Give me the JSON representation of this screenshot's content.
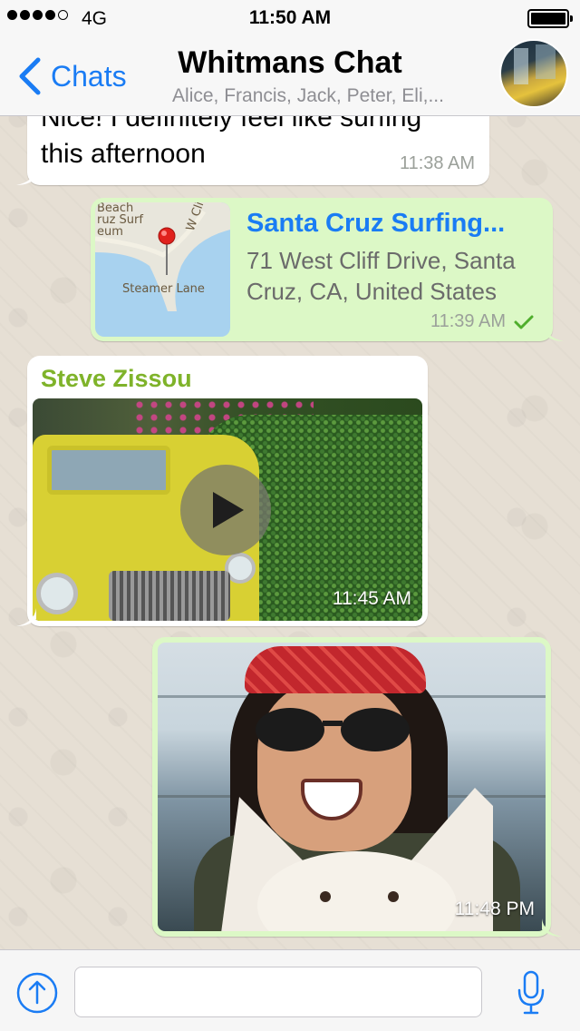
{
  "status_bar": {
    "network": "4G",
    "time": "11:50 AM",
    "signal_bars_filled": 4,
    "signal_bars_total": 5
  },
  "nav": {
    "back_label": "Chats",
    "title": "Whitmans Chat",
    "subtitle": "Alice, Francis, Jack, Peter, Eli,..."
  },
  "messages": [
    {
      "type": "text",
      "direction": "incoming",
      "text_line1": "Nice! I definitely feel like surfing",
      "text_line2": "this afternoon",
      "time": "11:38 AM"
    },
    {
      "type": "location",
      "direction": "outgoing",
      "title": "Santa Cruz Surfing...",
      "address_line1": "71 West Cliff Drive, Santa",
      "address_line2": "Cruz, CA, United States",
      "time": "11:39 AM",
      "status": "delivered",
      "map_labels": [
        "Beach",
        "ruz Surf",
        "eum",
        "W Cli",
        "Steamer Lane"
      ]
    },
    {
      "type": "video",
      "direction": "incoming",
      "sender": "Steve Zissou",
      "time": "11:45 AM"
    },
    {
      "type": "photo",
      "direction": "outgoing",
      "time": "11:48 PM"
    }
  ],
  "input": {
    "value": "",
    "placeholder": ""
  },
  "colors": {
    "accent": "#1a7cf4",
    "outgoing_bubble": "#dcf8c6",
    "incoming_bubble": "#ffffff",
    "sender_name": "#7fb32a",
    "check": "#4fae2c"
  },
  "icons": {
    "back": "chevron-left-icon",
    "attach": "upload-arrow-icon",
    "mic": "microphone-icon",
    "play": "play-icon",
    "check": "checkmark-icon",
    "pin": "map-pin-icon"
  }
}
